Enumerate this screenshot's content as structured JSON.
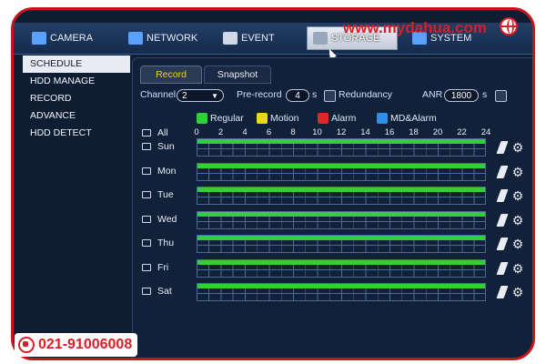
{
  "watermark": {
    "url": "www.mydahua.com",
    "phone": "021-91006008"
  },
  "topbar": {
    "tabs": [
      {
        "label": "CAMERA",
        "icon": "camera-icon",
        "color": "#5aa0ff"
      },
      {
        "label": "NETWORK",
        "icon": "network-icon",
        "color": "#5aa0ff"
      },
      {
        "label": "EVENT",
        "icon": "event-icon",
        "color": "#d0d8e8"
      },
      {
        "label": "STORAGE",
        "icon": "storage-icon",
        "color": "#d0d8e8",
        "active": true
      },
      {
        "label": "SYSTEM",
        "icon": "system-icon",
        "color": "#5aa0ff"
      }
    ]
  },
  "sidebar": {
    "items": [
      {
        "label": "SCHEDULE",
        "active": true
      },
      {
        "label": "HDD MANAGE"
      },
      {
        "label": "RECORD"
      },
      {
        "label": "ADVANCE"
      },
      {
        "label": "HDD DETECT"
      }
    ]
  },
  "subtabs": {
    "record": "Record",
    "snapshot": "Snapshot"
  },
  "settings": {
    "channel_label": "Channel",
    "channel_value": "2",
    "prerecord_label": "Pre-record",
    "prerecord_value": "4",
    "prerecord_unit": "s",
    "redundancy_label": "Redundancy",
    "anr_label": "ANR",
    "anr_value": "1800",
    "anr_unit": "s"
  },
  "legend": [
    {
      "label": "Regular",
      "color": "#2fd13a"
    },
    {
      "label": "Motion",
      "color": "#e8d81a"
    },
    {
      "label": "Alarm",
      "color": "#e02626"
    },
    {
      "label": "MD&Alarm",
      "color": "#2f8fe6"
    }
  ],
  "schedule": {
    "all_label": "All",
    "hours": [
      "0",
      "2",
      "4",
      "6",
      "8",
      "10",
      "12",
      "14",
      "16",
      "18",
      "20",
      "22",
      "24"
    ],
    "days": [
      "Sun",
      "Mon",
      "Tue",
      "Wed",
      "Thu",
      "Fri",
      "Sat"
    ],
    "record_type": "Regular"
  }
}
